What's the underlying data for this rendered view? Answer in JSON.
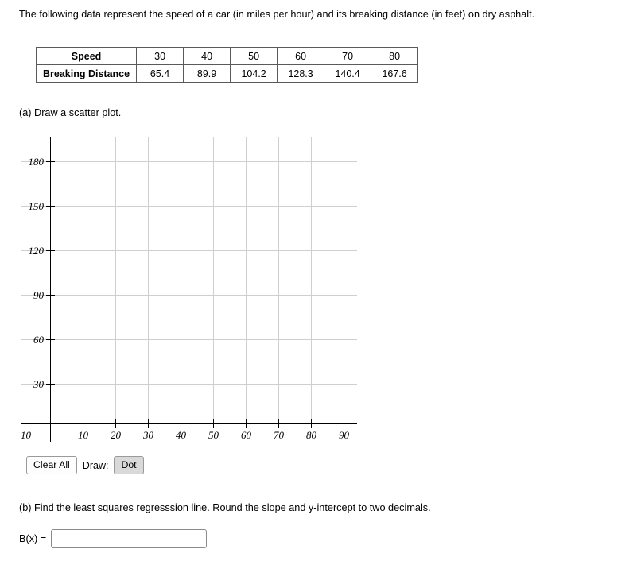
{
  "intro": {
    "text": "The following data represent the speed of a car (in miles per hour) and its breaking distance (in feet) on dry asphalt."
  },
  "table": {
    "row_labels": [
      "Speed",
      "Breaking Distance"
    ],
    "speed": [
      "30",
      "40",
      "50",
      "60",
      "70",
      "80"
    ],
    "distance": [
      "65.4",
      "89.9",
      "104.2",
      "128.3",
      "140.4",
      "167.6"
    ]
  },
  "parts": {
    "a": "(a) Draw a scatter plot.",
    "b": "(b) Find the least squares regresssion line. Round the slope and y-intercept to two decimals."
  },
  "toolbar": {
    "clear_all": "Clear All",
    "draw_label": "Draw:",
    "dot": "Dot"
  },
  "answer": {
    "label": "B(x) =",
    "value": "",
    "placeholder": ""
  },
  "chart_data": {
    "type": "scatter",
    "title": "",
    "xlabel": "",
    "ylabel": "",
    "xlim": [
      -5,
      100
    ],
    "ylim": [
      -14,
      200
    ],
    "x_ticks": [
      10,
      20,
      30,
      40,
      50,
      60,
      70,
      80,
      90
    ],
    "y_ticks": [
      30,
      60,
      90,
      120,
      150,
      180
    ],
    "origin_label": "10",
    "grid": true,
    "grid_color": "#cfcfcf",
    "axis_color": "#000000",
    "points": [],
    "series_x": [
      30,
      40,
      50,
      60,
      70,
      80
    ],
    "series_y": [
      65.4,
      89.9,
      104.2,
      128.3,
      140.4,
      167.6
    ]
  }
}
